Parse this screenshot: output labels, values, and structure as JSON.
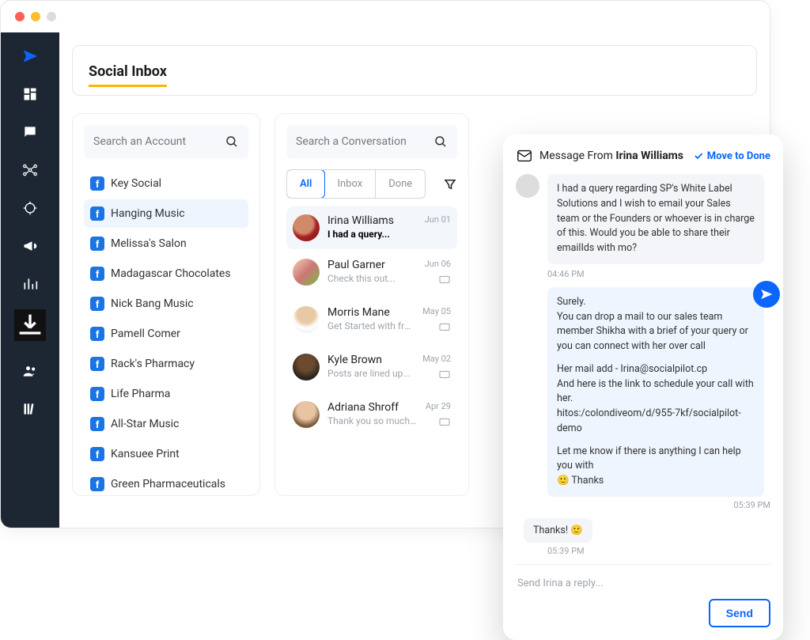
{
  "page": {
    "title": "Social Inbox"
  },
  "colors": {
    "accent_blue": "#0a66ff",
    "accent_yellow": "#ffb400",
    "sidebar_bg": "#1d2733"
  },
  "sidebar": {
    "icons": [
      {
        "name": "paper-plane-icon"
      },
      {
        "name": "dashboard-icon"
      },
      {
        "name": "chat-icon"
      },
      {
        "name": "network-icon"
      },
      {
        "name": "target-icon"
      },
      {
        "name": "megaphone-icon"
      },
      {
        "name": "analytics-icon"
      },
      {
        "name": "download-tray-icon"
      },
      {
        "name": "team-icon"
      },
      {
        "name": "library-icon"
      }
    ]
  },
  "accounts": {
    "search_placeholder": "Search an Account",
    "items": [
      {
        "label": "Key Social"
      },
      {
        "label": "Hanging Music"
      },
      {
        "label": "Melissa's Salon"
      },
      {
        "label": "Madagascar Chocolates"
      },
      {
        "label": "Nick Bang Music"
      },
      {
        "label": "Pamell Comer"
      },
      {
        "label": "Rack's Pharmacy"
      },
      {
        "label": "Life Pharma"
      },
      {
        "label": "All-Star Music"
      },
      {
        "label": "Kansuee Print"
      },
      {
        "label": "Green Pharmaceuticals"
      }
    ],
    "active_index": 1
  },
  "conversations": {
    "search_placeholder": "Search a Conversation",
    "tabs": {
      "all": "All",
      "inbox": "Inbox",
      "done": "Done"
    },
    "items": [
      {
        "name": "Irina Williams",
        "preview": "I had a query...",
        "date": "Jun 01",
        "avatar": "irina",
        "unread": true
      },
      {
        "name": "Paul Garner",
        "preview": "Check this out...",
        "date": "Jun 06",
        "avatar": "paul"
      },
      {
        "name": "Morris Mane",
        "preview": "Get Started with free...",
        "date": "May 05",
        "avatar": "morris"
      },
      {
        "name": "Kyle Brown",
        "preview": "Posts are lined up...",
        "date": "May 02",
        "avatar": "kyle"
      },
      {
        "name": "Adriana Shroff",
        "preview": "Thank you so much ...",
        "date": "Apr 29",
        "avatar": "adri"
      }
    ]
  },
  "detail": {
    "header_prefix": "Message From ",
    "header_name": "Irina Williams",
    "move_to_done": "Move to Done",
    "message_in": "I had a query regarding SP's White Label Solutions and I wish to email your Sales team or the Founders or whoever is in charge of this. Would you be able to share their emailIds with mo?",
    "time_in": "04:46 PM",
    "reply_line1": "Surely.",
    "reply_line2": "You can drop a mail to our sales team member Shikha with a brief of your query or you can connect with her over call",
    "reply_line3": "Her mail add - Irina@socialpilot.cp",
    "reply_line4": "And here is the link to schedule your call with her.",
    "reply_line5": "hitos:/colondiveom/d/955-7kf/socialpilot-demo",
    "reply_line6": "Let me know if there is anything I can help you with",
    "reply_line7": "🙂 Thanks",
    "time_reply": "05:39 PM",
    "thanks_text": "Thanks! 🙂",
    "thanks_time": "05:39 PM",
    "reply_placeholder": "Send Irina a reply...",
    "send_button": "Send"
  }
}
